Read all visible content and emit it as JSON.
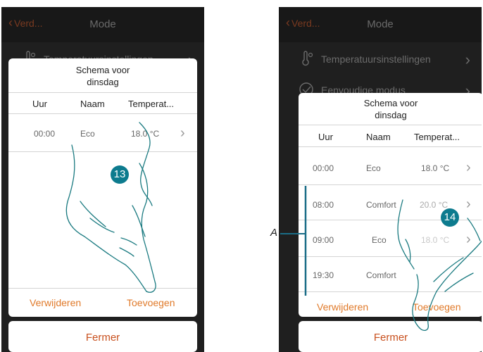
{
  "left": {
    "header": {
      "back_label": "Verd...",
      "title": "Mode"
    },
    "bg_row1": "Temperatuursinstellingen",
    "dialog": {
      "title_line1": "Schema voor",
      "title_line2": "dinsdag",
      "columns": [
        "Uur",
        "Naam",
        "Temperat..."
      ],
      "rows": [
        {
          "time": "00:00",
          "name": "Eco",
          "temp": "18.0 °C"
        }
      ],
      "delete_label": "Verwijderen",
      "add_label": "Toevoegen"
    },
    "close_label": "Fermer",
    "step": "13"
  },
  "right": {
    "header": {
      "back_label": "Verd...",
      "title": "Mode"
    },
    "bg_row1": "Temperatuursinstellingen",
    "bg_row2": "Eenvoudige modus",
    "dialog": {
      "title_line1": "Schema voor",
      "title_line2": "dinsdag",
      "columns": [
        "Uur",
        "Naam",
        "Temperat..."
      ],
      "rows": [
        {
          "time": "00:00",
          "name": "Eco",
          "temp": "18.0 °C"
        },
        {
          "time": "08:00",
          "name": "Comfort",
          "temp": "20.0 °C"
        },
        {
          "time": "09:00",
          "name": "Eco",
          "temp": "18.0 °C"
        },
        {
          "time": "19:30",
          "name": "Comfort",
          "temp": ""
        }
      ],
      "delete_label": "Verwijderen",
      "add_label": "Toevoegen"
    },
    "close_label": "Fermer",
    "step": "14"
  },
  "annotation_label": "A",
  "colors": {
    "accent": "#e07a2a",
    "close": "#c8501e",
    "step_badge": "#0d7b8e",
    "bracket": "#1a6d87"
  },
  "icons": [
    "back-chevron-icon",
    "thermometer-icon",
    "check-circle-icon",
    "chevron-right-icon",
    "hand-pointer-icon"
  ]
}
